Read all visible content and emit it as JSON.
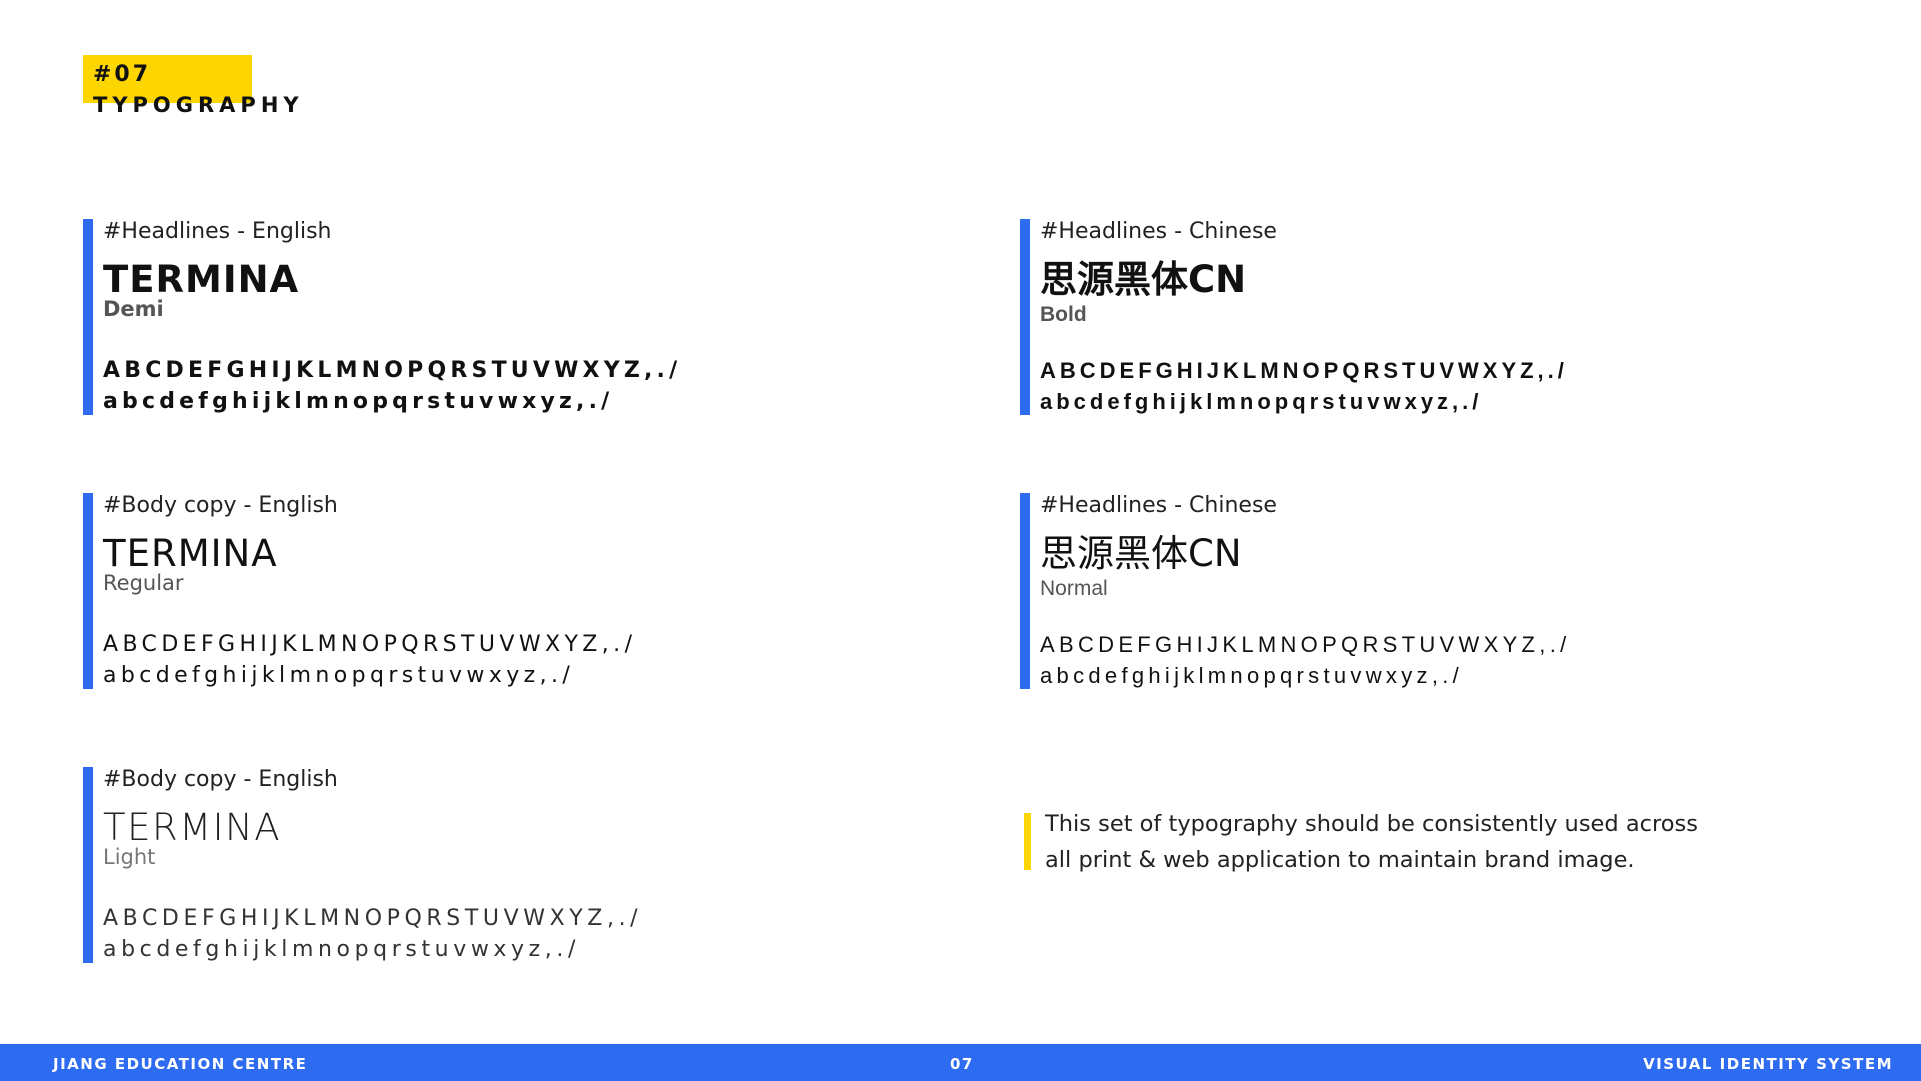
{
  "section": {
    "number": "#07",
    "title": "TYPOGRAPHY"
  },
  "blocks": [
    {
      "label": "#Headlines - English",
      "name": "TERMINA",
      "weight": "Demi",
      "upper": "ABCDEFGHIJKLMNOPQRSTUVWXYZ,./",
      "lower": "abcdefghijklmnopqrstuvwxyz,./"
    },
    {
      "label": "#Body copy - English",
      "name": "TERMINA",
      "weight": "Regular",
      "upper": "ABCDEFGHIJKLMNOPQRSTUVWXYZ,./",
      "lower": "abcdefghijklmnopqrstuvwxyz,./"
    },
    {
      "label": "#Body copy - English",
      "name": "TERMINA",
      "weight": "Light",
      "upper": "ABCDEFGHIJKLMNOPQRSTUVWXYZ,./",
      "lower": "abcdefghijklmnopqrstuvwxyz,./"
    },
    {
      "label": "#Headlines - Chinese",
      "name": "思源黑体CN",
      "weight": "Bold",
      "upper": "ABCDEFGHIJKLMNOPQRSTUVWXYZ,./",
      "lower": "abcdefghijklmnopqrstuvwxyz,./"
    },
    {
      "label": "#Headlines - Chinese",
      "name": "思源黑体CN",
      "weight": "Normal",
      "upper": "ABCDEFGHIJKLMNOPQRSTUVWXYZ,./",
      "lower": "abcdefghijklmnopqrstuvwxyz,./"
    }
  ],
  "note": {
    "line1": "This set of typography should be consistently used across",
    "line2": "all print & web application to maintain brand image."
  },
  "footer": {
    "left": "JIANG EDUCATION CENTRE",
    "page": "07",
    "right": "VISUAL IDENTITY SYSTEM"
  },
  "colors": {
    "accent_blue": "#2D6BF0",
    "accent_yellow": "#FDD500"
  }
}
